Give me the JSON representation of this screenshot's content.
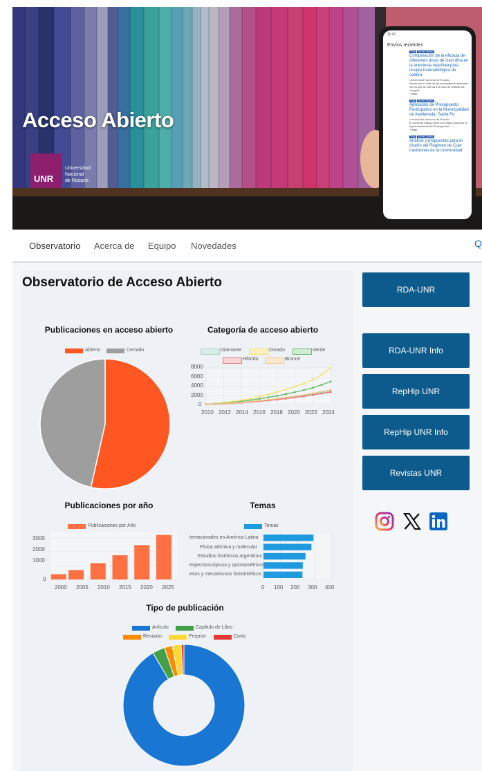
{
  "hero": {
    "title": "Acceso Abierto",
    "logo_text": "UNR",
    "logo_sub": [
      "Universidad",
      "Nacional",
      "de Rosario"
    ],
    "phone": {
      "heading": "Envíos recientes",
      "items": [
        {
          "tags": [
            "Tesis",
            "Acceso Abierto"
          ],
          "title": "Comparación de la eficacia de diferentes dosis de clavi dina en la anestesia raquídea para cirugía traumatológica de cadera",
          "meta": "Universidad Nacional de Rosario",
          "abstract": "Introducción: Una de las principales limitaciones con la que se cuenta a la hora de realizar las cirugías ...",
          "more": "+ Más"
        },
        {
          "tags": [
            "Tesis",
            "Acceso Abierto"
          ],
          "title": "Aplicación de Presupuesto Participativo en la Municipalidad de Avellaneda, Santa Fe",
          "meta": "Universidad Nacional de Rosario",
          "abstract": "El presente trabajo tiene por objeto proponer la implementación del Presupuesto ...",
          "more": "+ Más"
        },
        {
          "tags": [
            "Tesis",
            "Acceso Abierto"
          ],
          "title": "Análisis y propuestas para el diseño del Régimen de Cuer hasiciones de la Universidad",
          "meta": "",
          "abstract": "",
          "more": ""
        }
      ]
    }
  },
  "nav": {
    "items": [
      "Observatorio",
      "Acerca de",
      "Equipo",
      "Novedades"
    ],
    "more": "Q"
  },
  "observatorio": {
    "title": "Observatorio de Acceso Abierto"
  },
  "sidebar": {
    "buttons": [
      "RDA-UNR",
      "RDA-UNR Info",
      "RepHip UNR",
      "RepHip UNR Info",
      "Revistas UNR"
    ],
    "social": [
      "instagram-icon",
      "x-icon",
      "linkedin-icon"
    ]
  },
  "colors": {
    "button": "#0d5a8c",
    "logo": "#8e1f6f"
  },
  "chart_data": [
    {
      "type": "pie",
      "title": "Publicaciones en acceso abierto",
      "labels": [
        "Abierto",
        "Cerrado"
      ],
      "values": [
        53.5,
        46.5
      ],
      "colors": [
        "#ff5722",
        "#9e9e9e"
      ],
      "legend": "top"
    },
    {
      "type": "line",
      "title": "Categoría de acceso abierto",
      "x": [
        2010,
        2011,
        2012,
        2013,
        2014,
        2015,
        2016,
        2017,
        2018,
        2019,
        2020,
        2021,
        2022,
        2023,
        2024
      ],
      "xticks": [
        "2010",
        "2012",
        "2014",
        "2016",
        "2018",
        "2020",
        "2022",
        "2024"
      ],
      "yticks": [
        "8000",
        "6000",
        "4000",
        "2000",
        "0"
      ],
      "ylim": [
        0,
        8000
      ],
      "series": [
        {
          "name": "Diamante",
          "color": "#9fd6c9",
          "values": [
            50,
            100,
            200,
            300,
            450,
            600,
            800,
            1000,
            1200,
            1450,
            1700,
            2000,
            2300,
            2600,
            2900
          ]
        },
        {
          "name": "Dorado",
          "color": "#f7e36c",
          "values": [
            80,
            200,
            400,
            650,
            950,
            1300,
            1700,
            2200,
            2700,
            3300,
            3900,
            4600,
            5400,
            6500,
            8000
          ]
        },
        {
          "name": "Verde",
          "color": "#66bb6a",
          "values": [
            60,
            150,
            300,
            480,
            700,
            950,
            1250,
            1550,
            1900,
            2300,
            2700,
            3150,
            3650,
            4300,
            5000
          ]
        },
        {
          "name": "Híbrido",
          "color": "#e57373",
          "values": [
            30,
            80,
            150,
            250,
            380,
            520,
            700,
            880,
            1080,
            1300,
            1550,
            1800,
            2100,
            2400,
            2700
          ]
        },
        {
          "name": "Bronce",
          "color": "#f0c88a",
          "values": [
            40,
            100,
            200,
            320,
            470,
            650,
            850,
            1050,
            1300,
            1550,
            1800,
            2100,
            2450,
            2800,
            3200
          ]
        }
      ],
      "legend": "top"
    },
    {
      "type": "bar",
      "title": "Publicaciones por año",
      "series": [
        {
          "name": "Publicaciones por Año",
          "color": "#ff7043"
        }
      ],
      "categories": [
        "2000",
        "2003",
        "2006",
        "2009",
        "2012",
        "2015",
        "2018",
        "2021",
        "2024"
      ],
      "xticks": [
        "2000",
        "2005",
        "2010",
        "2015",
        "2020",
        "2025"
      ],
      "values": [
        380,
        680,
        1180,
        1750,
        2480,
        3220
      ],
      "bar_years": [
        2000,
        2004,
        2009,
        2014,
        2019,
        2024
      ],
      "yticks": [
        "3000",
        "2000",
        "1000",
        "0"
      ],
      "ylim": [
        0,
        3400
      ],
      "legend": "top"
    },
    {
      "type": "bar",
      "orientation": "horizontal",
      "title": "Temas",
      "series": [
        {
          "name": "Temas",
          "color": "#1e9be0"
        }
      ],
      "categories": [
        "ternacionales en América Latina",
        "Física atómica y molecular",
        "Estudios históricos argentinos",
        "espectroscópicos y quimiométricos",
        "esos y mecanismos fotosintéticos"
      ],
      "values": [
        295,
        283,
        248,
        232,
        230
      ],
      "xticks": [
        "0",
        "100",
        "200",
        "300",
        "400"
      ],
      "xlim": [
        0,
        400
      ],
      "legend": "top"
    },
    {
      "type": "pie",
      "subtype": "doughnut",
      "title": "Tipo de publicación",
      "labels": [
        "Artículo",
        "Capítulo de Libro",
        "Revisión",
        "Preprint",
        "Carta"
      ],
      "values": [
        91.5,
        3.3,
        2.1,
        2.4,
        0.7
      ],
      "colors": [
        "#1976d2",
        "#43a047",
        "#fb8c00",
        "#fdd835",
        "#e53935"
      ],
      "legend": "top"
    }
  ]
}
